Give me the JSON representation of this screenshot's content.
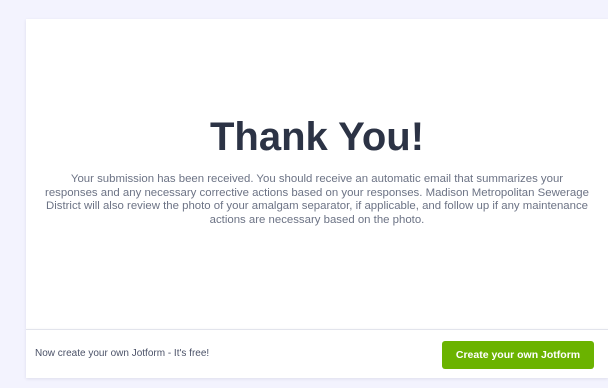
{
  "thank_you": {
    "title": "Thank You!",
    "message": "Your submission has been received. You should receive an automatic email that summarizes your responses and any necessary corrective actions based on your responses. Madison Metropolitan Sewerage District will also review the photo of your amalgam separator, if applicable, and follow up if any maintenance actions are necessary based on the photo."
  },
  "footer": {
    "promo_text": "Now create your own Jotform - It's free!",
    "cta_label": "Create your own Jotform"
  },
  "colors": {
    "background": "#f3f3fe",
    "title": "#2c3345",
    "body_text": "#6c7385",
    "cta": "#6bb300"
  }
}
